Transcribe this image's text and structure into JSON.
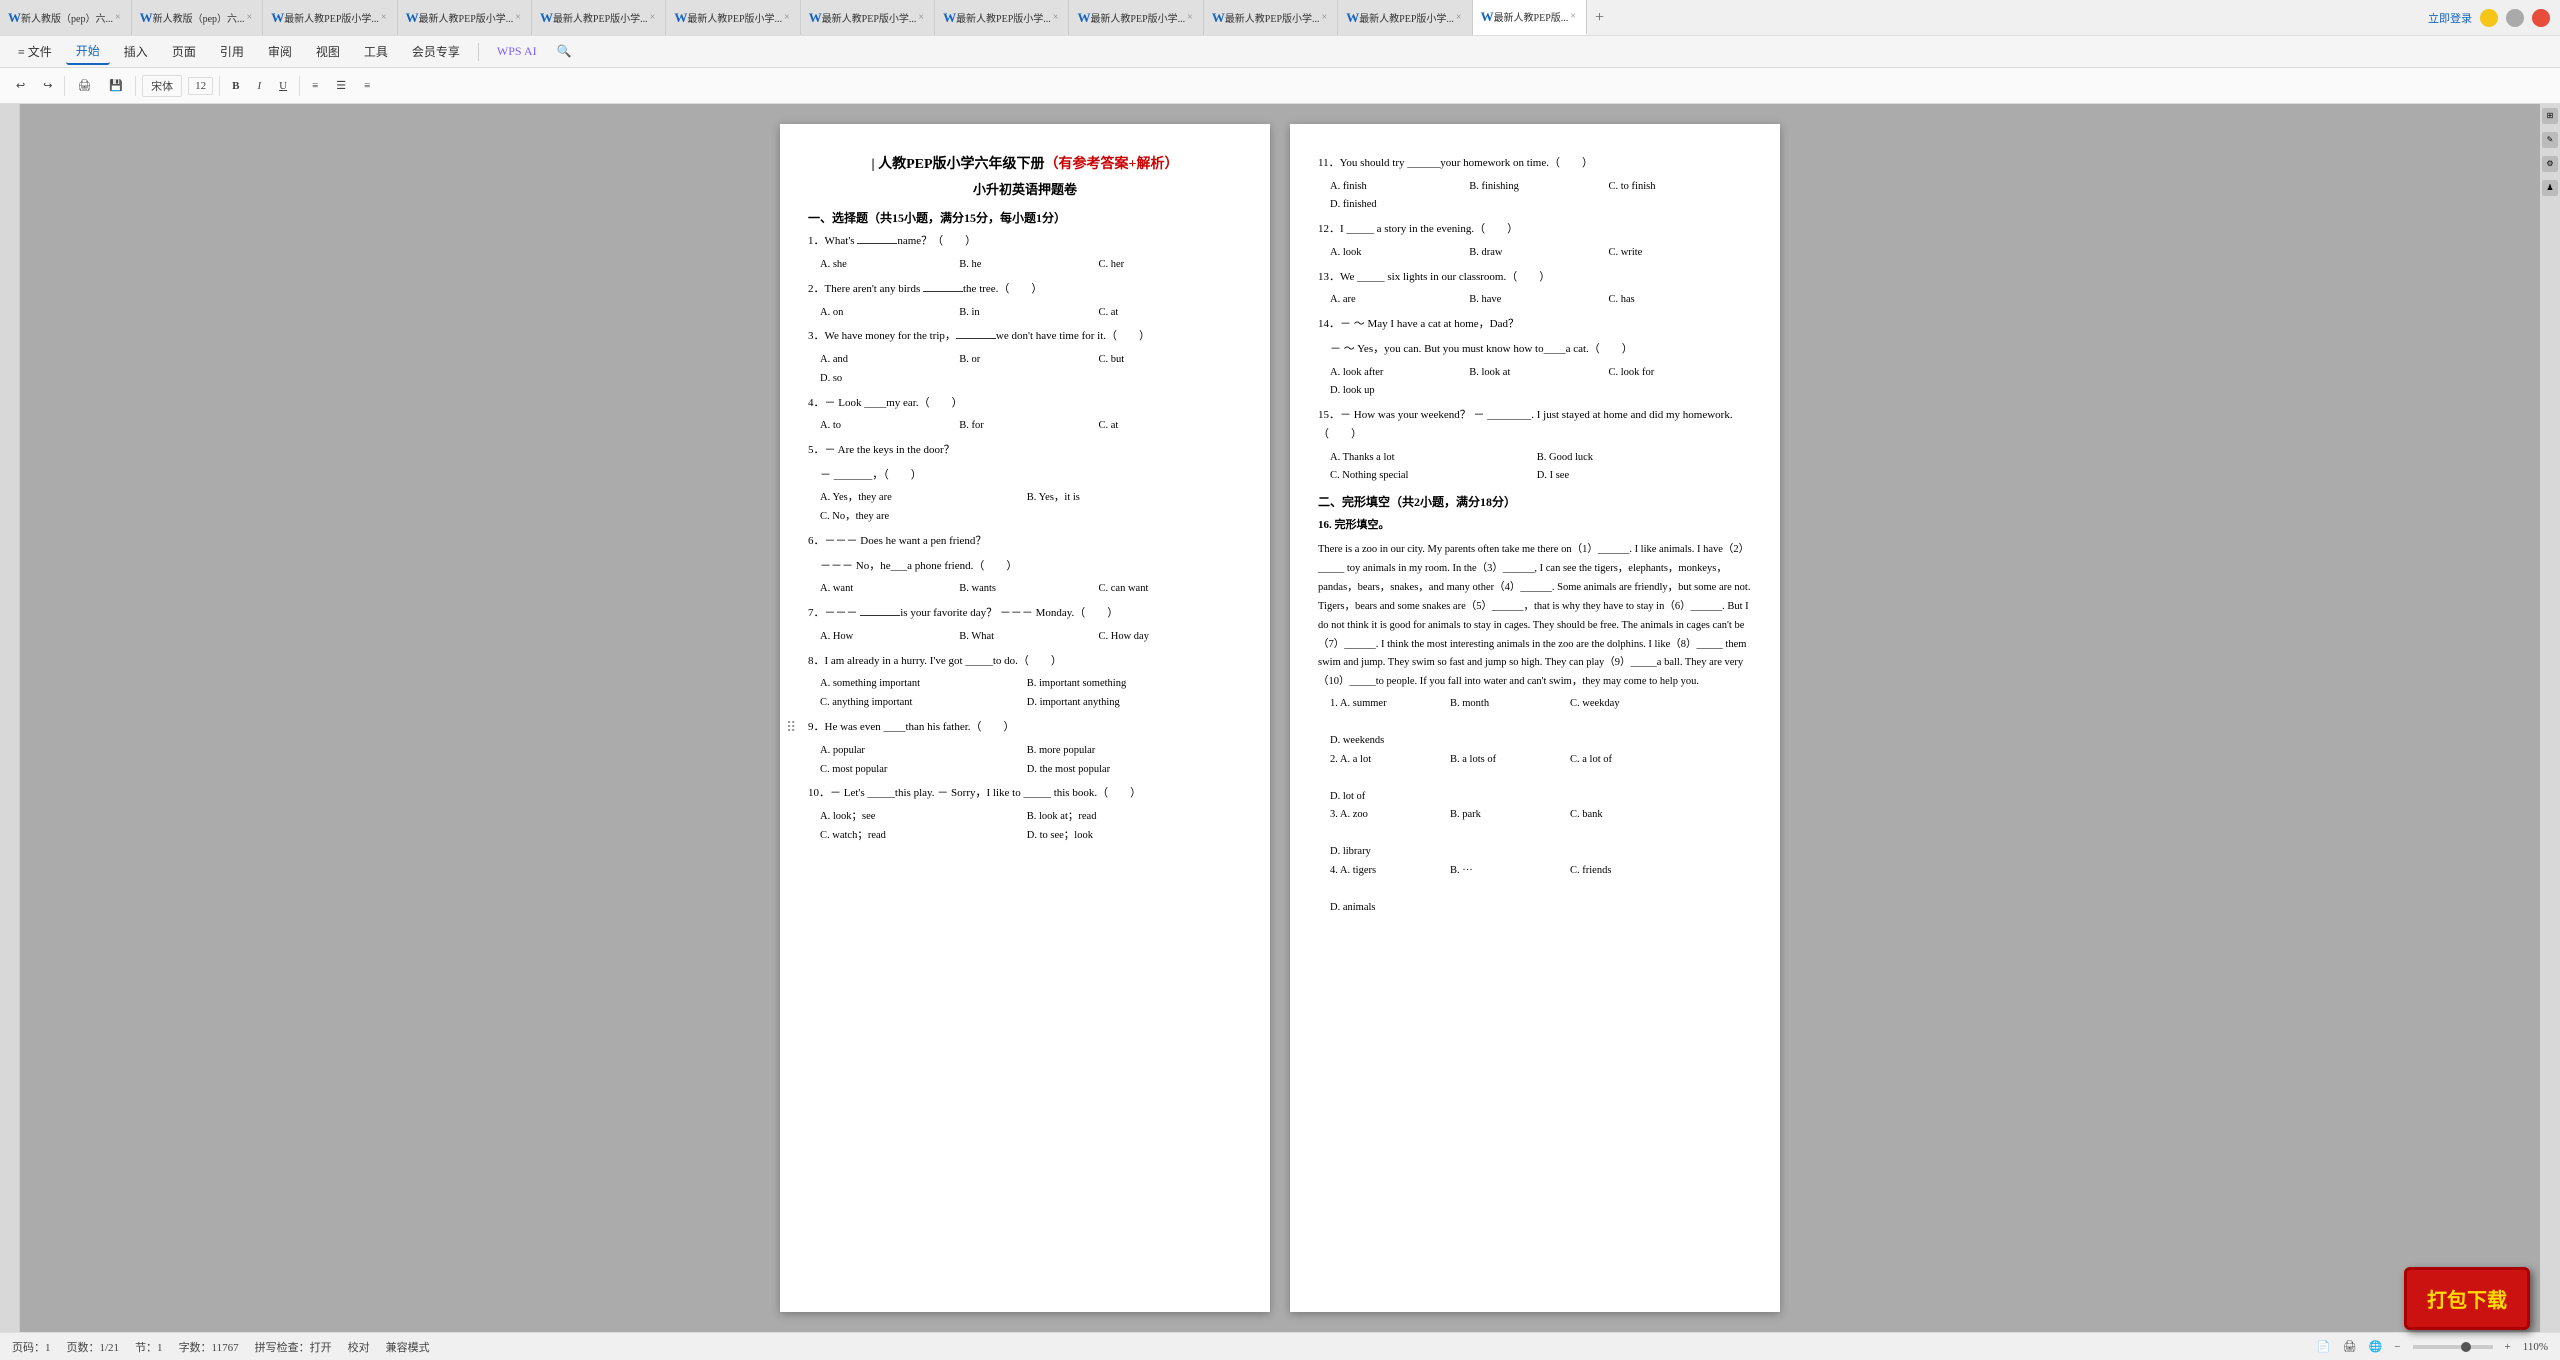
{
  "titlebar": {
    "tabs": [
      {
        "label": "新人教版（pep）六...",
        "active": false
      },
      {
        "label": "新人教版（pep）六...",
        "active": false
      },
      {
        "label": "最新人教PEP版小学...",
        "active": false
      },
      {
        "label": "最新人教PEP版小学...",
        "active": false
      },
      {
        "label": "最新人教PEP版小学...",
        "active": false
      },
      {
        "label": "最新人教PEP版小学...",
        "active": false
      },
      {
        "label": "最新人教PEP版小学...",
        "active": false
      },
      {
        "label": "最新人教PEP版小学...",
        "active": false
      },
      {
        "label": "最新人教PEP版小学...",
        "active": false
      },
      {
        "label": "最新人教PEP版小学...",
        "active": false
      },
      {
        "label": "最新人教PEP版小学...",
        "active": false
      },
      {
        "label": "最新人教PEP版...",
        "active": true
      }
    ],
    "add_tab": "+",
    "window_controls": [
      "—",
      "□",
      "✕"
    ],
    "right_label": "立即登录"
  },
  "menubar": {
    "items": [
      "≡ 文件",
      "开始",
      "插入",
      "页面",
      "引用",
      "审阅",
      "视图",
      "工具",
      "会员专享"
    ],
    "active": "开始",
    "wps_ai": "WPS AI",
    "search_icon": "🔍"
  },
  "toolbar": {
    "items": [
      "页码:1",
      "页数: 1/21",
      "节:1",
      "字数: 11767",
      "拼写检查:打开",
      "校对",
      "兼容模式"
    ]
  },
  "page_left": {
    "title": "| 人教PEP版小学六年级下册",
    "title_red": "(有参考答案+解析)",
    "subtitle": "小升初英语押题卷",
    "section1_title": "一、选择题（共15小题，满分15分，每小题1分）",
    "questions": [
      {
        "num": "1",
        "text": "What's _____ name？（　　）",
        "options": [
          "A. she",
          "B. he",
          "C. her"
        ]
      },
      {
        "num": "2",
        "text": "There aren't any birds _____ the tree.（　　）",
        "options": [
          "A. on",
          "B. in",
          "C. at"
        ]
      },
      {
        "num": "3",
        "text": "We have money for the trip，_____we don't have time for it.（　　）",
        "options": [
          "A. and",
          "B. or",
          "C. but",
          "D. so"
        ]
      },
      {
        "num": "4",
        "text": "－ Look ____my ear.（　　）",
        "options": [
          "A. to",
          "B. for",
          "C. at"
        ]
      },
      {
        "num": "5",
        "text": "－ Are the keys in the door？",
        "sub": "－ _______,（　　）",
        "options": [
          "A. Yes，they are",
          "B. Yes，it is",
          "C. No，they are"
        ]
      },
      {
        "num": "6",
        "text": "－－－ Does he want a pen friend？",
        "sub": "－－－ No，he___a phone friend.（　　）",
        "options": [
          "A. want",
          "B. wants",
          "C. can want"
        ]
      },
      {
        "num": "7",
        "text": "－－－ _______ is your favorite day？ －－－ Monday.（　　）",
        "options": [
          "A. How",
          "B. What",
          "C. How day"
        ]
      },
      {
        "num": "8",
        "text": "I am already in a hurry. I've got _____to do.（　　）",
        "options": [
          "A. something important",
          "B. important something",
          "C. anything important",
          "D. important anything"
        ]
      },
      {
        "num": "9",
        "text": "He was even ____than his father.（　　）",
        "options": [
          "A. popular",
          "B. more popular",
          "C. most popular",
          "D. the most popular"
        ]
      },
      {
        "num": "10",
        "text": "－ Let's _____this play. － Sorry，I like to _____ this book.（　　）",
        "options": [
          "A. look；see",
          "B. look at；read",
          "C. watch；read",
          "D. to see；look"
        ]
      }
    ]
  },
  "page_right": {
    "questions": [
      {
        "num": "11",
        "text": "You should try ______your homework on time.（　　）",
        "options": [
          "A. finish",
          "B. finishing",
          "C. to finish",
          "D. finished"
        ]
      },
      {
        "num": "12",
        "text": "I _____ a story in the evening.（　　）",
        "options": [
          "A. look",
          "B. draw",
          "C. write"
        ]
      },
      {
        "num": "13",
        "text": "We _____ six lights in our classroom.（　　）",
        "options": [
          "A. are",
          "B. have",
          "C. has"
        ]
      },
      {
        "num": "14",
        "text": "－ ～ May I have a cat at home，Dad？",
        "sub": "－ ～ Yes，you can. But you must know how to____a cat.（　　）",
        "options": [
          "A. look after",
          "B. look at",
          "C. look for",
          "D. look up"
        ]
      },
      {
        "num": "15",
        "text": "－ How was your weekend？ － ________. I just stayed at home and did my homework.（　　）",
        "options": [
          "A. Thanks a lot",
          "B. Good luck",
          "C. Nothing special",
          "D. I see"
        ]
      }
    ],
    "section2_title": "二、完形填空（共2小题，满分18分）",
    "section2_sub": "16. 完形填空。",
    "passage": "There is a zoo in our city. My parents often take me there on（1）______. I like animals. I have（2）_____ toy animals in my room. In the（3）______, I can see the tigers，elephants，monkeys，pandas，bears，snakes，and many other（4）______. Some animals are friendly，but some are not. Tigers，bears and some snakes are（5）______，that is why they have to stay in（6）______. But I do not think it is good for animals to stay in cages. They should be free. The animals in cages can't be（7）______. I think the most interesting animals in the zoo are the dolphins. I like（8）_____ them swim and jump. They swim so fast and jump so high. They can play（9）_____a ball. They are very（10）_____to people. If you fall into water and can't swim，they may come to help you.",
    "blanks": [
      {
        "num": "1",
        "options": [
          "A. summer",
          "B. month",
          "C. weekday",
          "D. weekends"
        ]
      },
      {
        "num": "2",
        "options": [
          "A. a lot",
          "B. a lots of",
          "C. a lot of",
          "D. lot of"
        ]
      },
      {
        "num": "3",
        "options": [
          "A. zoo",
          "B. park",
          "C. bank",
          "D. library"
        ]
      },
      {
        "num": "4",
        "options": [
          "A. tigers",
          "B. ...",
          "C. friends",
          "D. animals"
        ]
      }
    ]
  },
  "statusbar": {
    "page": "页码：1",
    "pages": "页数：1/21",
    "section": "节：1",
    "word_count": "字数：11767",
    "spell_check": "拼写检查：打开",
    "proofread": "校对",
    "compat_mode": "兼容模式",
    "zoom": "110%"
  },
  "download_badge": {
    "label": "打包下载"
  }
}
